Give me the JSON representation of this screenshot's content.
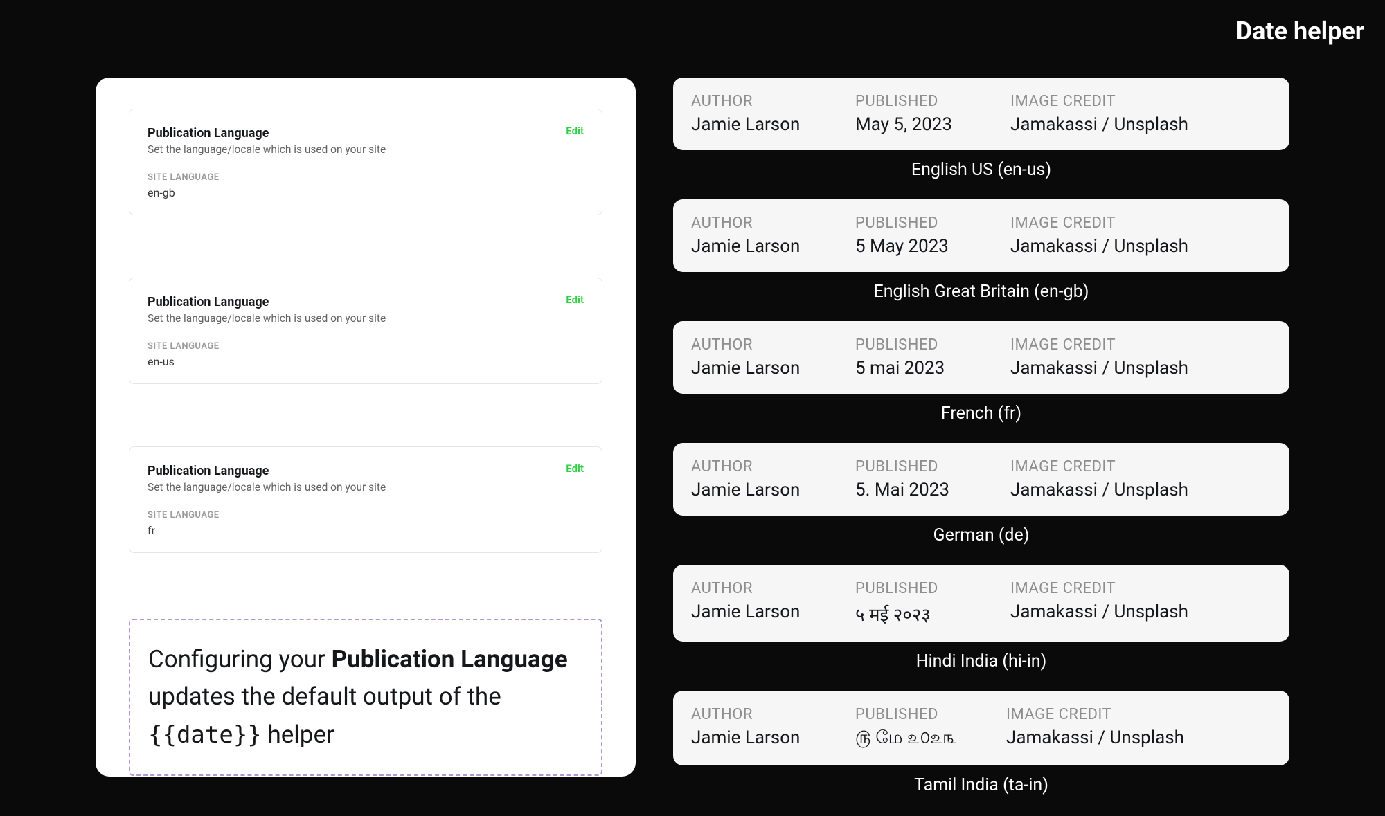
{
  "page": {
    "title": "Date helper"
  },
  "settings": {
    "cards": [
      {
        "title": "Publication Language",
        "description": "Set the language/locale which is used on your site",
        "label": "SITE LANGUAGE",
        "value": "en-gb",
        "edit": "Edit"
      },
      {
        "title": "Publication Language",
        "description": "Set the language/locale which is used on your site",
        "label": "SITE LANGUAGE",
        "value": "en-us",
        "edit": "Edit"
      },
      {
        "title": "Publication Language",
        "description": "Set the language/locale which is used on your site",
        "label": "SITE LANGUAGE",
        "value": "fr",
        "edit": "Edit"
      }
    ]
  },
  "callout": {
    "text1": "Configuring your ",
    "bold1": "Publication Language",
    "text2": " updates the default output of the ",
    "code": "{{date}}",
    "text3": " helper"
  },
  "previews": {
    "labels": {
      "author": "AUTHOR",
      "published": "PUBLISHED",
      "credit": "IMAGE CREDIT"
    },
    "items": [
      {
        "author": "Jamie Larson",
        "published": "May 5, 2023",
        "credit": "Jamakassi / Unsplash",
        "caption": "English US (en-us)"
      },
      {
        "author": "Jamie Larson",
        "published": "5 May 2023",
        "credit": "Jamakassi / Unsplash",
        "caption": "English Great Britain (en-gb)"
      },
      {
        "author": "Jamie Larson",
        "published": "5 mai 2023",
        "credit": "Jamakassi / Unsplash",
        "caption": "French (fr)"
      },
      {
        "author": "Jamie Larson",
        "published": "5. Mai 2023",
        "credit": "Jamakassi / Unsplash",
        "caption": "German (de)"
      },
      {
        "author": "Jamie Larson",
        "published": "५ मई २०२३",
        "credit": "Jamakassi / Unsplash",
        "caption": "Hindi India (hi-in)"
      },
      {
        "author": "Jamie Larson",
        "published": "௫ மே ௨௦௨௩",
        "credit": "Jamakassi / Unsplash",
        "caption": "Tamil India (ta-in)"
      }
    ]
  }
}
